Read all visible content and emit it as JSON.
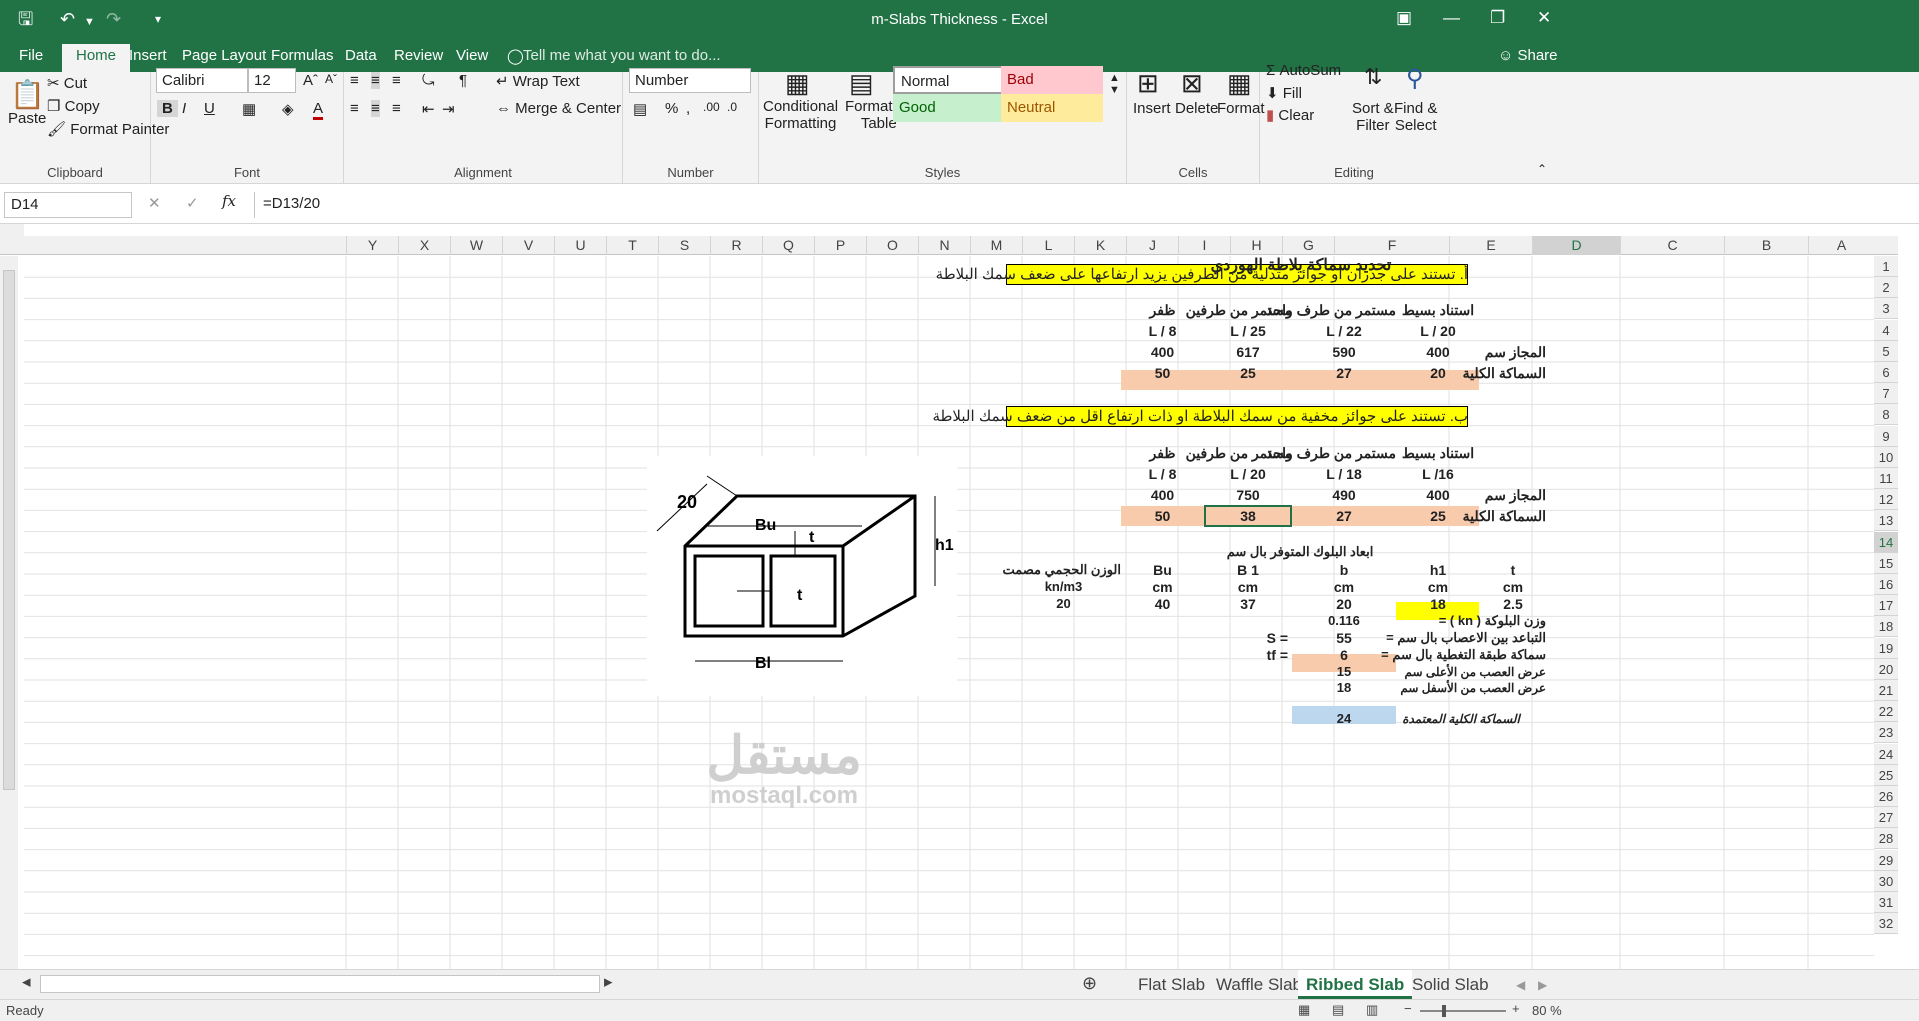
{
  "window": {
    "title": "m-Slabs Thickness - Excel",
    "share_label": "Share"
  },
  "tabs": [
    "File",
    "Home",
    "Insert",
    "Page Layout",
    "Formulas",
    "Data",
    "Review",
    "View"
  ],
  "tell_me": "Tell me what you want to do...",
  "ribbon": {
    "clipboard": {
      "paste": "Paste",
      "cut": "Cut",
      "copy": "Copy",
      "format_painter": "Format Painter",
      "label": "Clipboard"
    },
    "font": {
      "name": "Calibri",
      "size": "12",
      "label": "Font"
    },
    "alignment": {
      "wrap": "Wrap Text",
      "merge": "Merge & Center",
      "label": "Alignment"
    },
    "number": {
      "format": "Number",
      "label": "Number"
    },
    "styles": {
      "conditional": "Conditional",
      "conditional2": "Formatting",
      "format_as": "Format as",
      "format_as2": "Table",
      "normal": "Normal",
      "bad": "Bad",
      "good": "Good",
      "neutral": "Neutral",
      "label": "Styles"
    },
    "cells": {
      "insert": "Insert",
      "delete": "Delete",
      "format": "Format",
      "label": "Cells"
    },
    "editing": {
      "autosum": "AutoSum",
      "fill": "Fill",
      "clear": "Clear",
      "sort": "Sort &",
      "sort2": "Filter",
      "find": "Find &",
      "find2": "Select",
      "label": "Editing"
    }
  },
  "formula_bar": {
    "name_box": "D14",
    "formula": "=D13/20"
  },
  "columns": [
    "A",
    "B",
    "C",
    "D",
    "E",
    "F",
    "G",
    "H",
    "I",
    "J",
    "K",
    "L",
    "M",
    "N",
    "O",
    "P",
    "Q",
    "R",
    "S",
    "T",
    "U",
    "V",
    "W",
    "X",
    "Y"
  ],
  "rows": [
    "1",
    "2",
    "3",
    "4",
    "5",
    "6",
    "7",
    "8",
    "9",
    "10",
    "11",
    "12",
    "13",
    "14",
    "15",
    "16",
    "17",
    "18",
    "19",
    "20",
    "21",
    "22",
    "23",
    "24",
    "25",
    "26",
    "27",
    "28",
    "29",
    "30",
    "31",
    "32"
  ],
  "cells": {
    "title": "تحديد سماكة بلاطة الهوردي",
    "section_a": "أ. تستند على جدران او جوائز متدلية من الطرفين يزيد ارتفاعها على ضعف سمك البلاطة",
    "section_b": "ب. تستند على جوائز مخفية من سمك البلاطة او ذات ارتفاع اقل من ضعف سمك البلاطة",
    "h_simple": "استناد بسيط",
    "h_one": "مستمر من طرف واحد",
    "h_two": "مستمر من طرفين",
    "h_cant": "ظفر",
    "r5": [
      "L / 20",
      "L / 22",
      "L / 25",
      "L / 8"
    ],
    "span_label": "المجاز سم",
    "thick_label": "السماكة الكلية",
    "r6": [
      "400",
      "590",
      "617",
      "400"
    ],
    "r7": [
      "20",
      "27",
      "25",
      "50"
    ],
    "r12": [
      "L /16",
      "L / 18",
      "L / 20",
      "L / 8"
    ],
    "r13": [
      "400",
      "490",
      "750",
      "400"
    ],
    "r14": [
      "25",
      "27",
      "38",
      "50"
    ],
    "block_title": "ابعاد البلوك المتوفر  بال سم",
    "r17": [
      "t",
      "h1",
      "b",
      "B 1",
      "Bu"
    ],
    "r17f": "الوزن الحجمي مصمت",
    "r18": [
      "cm",
      "cm",
      "cm",
      "cm",
      "cm"
    ],
    "r18f": "kn/m3",
    "r19": [
      "2.5",
      "18",
      "20",
      "37",
      "40"
    ],
    "r19f": "20",
    "block_weight": "وزن البلوكة ( kn ) =",
    "block_weight_val": "0.116",
    "rib_spacing": "التباعد بين الاعصاب بال سم =",
    "rib_spacing_val": "55",
    "s_label": "S  =",
    "topping": "سماكة طبقة التغطية  بال سم =",
    "topping_val": "6",
    "tf_label": "tf =",
    "rib_top": "عرض العصب من الأعلى سم",
    "rib_top_val": "15",
    "rib_bottom": "عرض العصب من الأسفل سم",
    "rib_bottom_val": "18",
    "adopted": "السماكة الكلية المعتمدة",
    "adopted_val": "24"
  },
  "drawing": {
    "width_label": "20",
    "bu": "Bu",
    "t": "t",
    "h1": "h1",
    "bl": "Bl"
  },
  "watermark": {
    "arabic": "مستقل",
    "latin": "mostaql.com"
  },
  "sheet_tabs": [
    "Flat Slab",
    "Waffle Slab",
    "Ribbed Slab",
    "Solid Slab"
  ],
  "active_sheet": "Ribbed Slab",
  "status": {
    "ready": "Ready",
    "zoom": "80 %"
  }
}
